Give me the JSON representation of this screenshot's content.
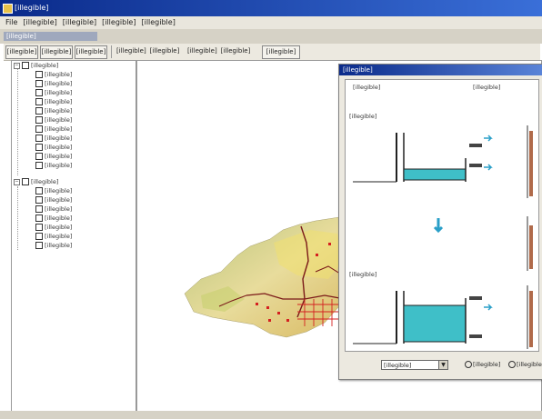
{
  "window": {
    "title": "[illegible]"
  },
  "menu": {
    "items": [
      "File",
      "[illegible]",
      "[illegible]",
      "[illegible]",
      "[illegible]"
    ]
  },
  "workspace": {
    "title": "[illegible]"
  },
  "toolbar": {
    "buttons": [
      "[illegible]",
      "[illegible]",
      "[illegible]",
      "[illegible]",
      "[illegible]",
      "[illegible]",
      "[illegible]",
      "[illegible]"
    ]
  },
  "tree": {
    "group1_label": "[illegible]",
    "group1_items": [
      "[illegible]",
      "[illegible]",
      "[illegible]",
      "[illegible]",
      "[illegible]",
      "[illegible]",
      "[illegible]",
      "[illegible]",
      "[illegible]",
      "[illegible]",
      "[illegible]"
    ],
    "group2_label": "[illegible]",
    "group2_items": [
      "[illegible]",
      "[illegible]",
      "[illegible]",
      "[illegible]",
      "[illegible]",
      "[illegible]",
      "[illegible]"
    ]
  },
  "dialog": {
    "title": "[illegible]",
    "header_left": "[illegible]",
    "header_right": "[illegible]",
    "section1": "[illegible]",
    "section2": "[illegible]",
    "scale_select": "[illegible]",
    "radio1": "[illegible]",
    "radio2": "[illegible]"
  },
  "colors": {
    "titlebar": "#0a2a8a",
    "water_fill": "#3fbfc8",
    "arrow": "#2a9fc8",
    "terrain_light": "#e8dc9c",
    "terrain_green": "#b8c47a",
    "terrain_red": "#d42020"
  }
}
